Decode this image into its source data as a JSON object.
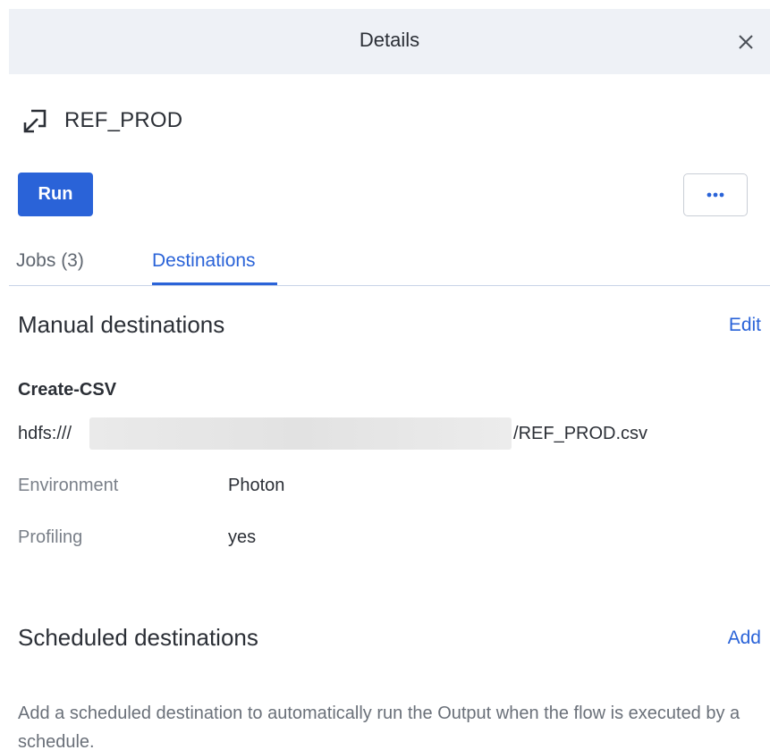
{
  "header": {
    "title": "Details",
    "close_icon": "close-icon"
  },
  "output": {
    "icon": "output-arrow-icon",
    "name": "REF_PROD"
  },
  "actions": {
    "run_label": "Run",
    "more_icon": "more-horizontal-icon"
  },
  "tabs": [
    {
      "label": "Jobs (3)",
      "active": false
    },
    {
      "label": "Destinations",
      "active": true
    }
  ],
  "manual": {
    "title": "Manual destinations",
    "action_label": "Edit",
    "destination": {
      "name": "Create-CSV",
      "path_prefix": "hdfs:///",
      "path_suffix": "/REF_PROD.csv",
      "fields": [
        {
          "label": "Environment",
          "value": "Photon"
        },
        {
          "label": "Profiling",
          "value": "yes"
        }
      ]
    }
  },
  "scheduled": {
    "title": "Scheduled destinations",
    "action_label": "Add",
    "info": "Add a scheduled destination to automatically run the Output when the flow is executed by a schedule."
  },
  "colors": {
    "accent": "#2a63d8",
    "header_bg": "#eef1f6",
    "text": "#2b2f36",
    "muted": "#7a8089"
  }
}
